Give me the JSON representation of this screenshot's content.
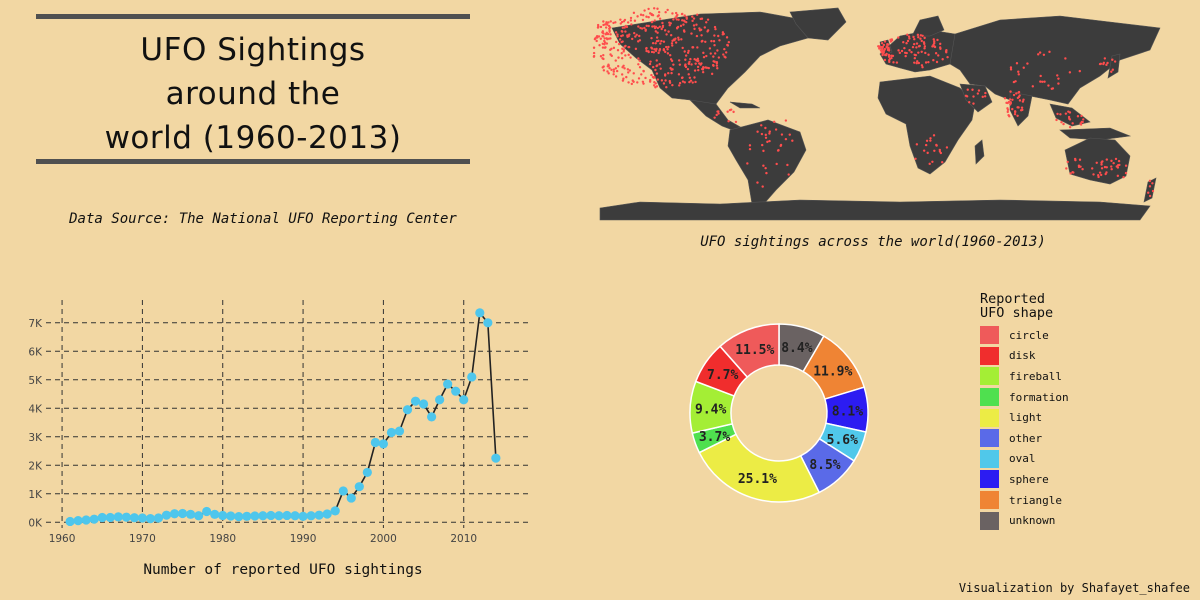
{
  "title": "UFO Sightings\naround the\nworld (1960-2013)",
  "data_source": "Data Source: The National UFO Reporting Center",
  "map_caption": "UFO sightings across the world(1960-2013)",
  "line_caption": "Number of reported UFO sightings",
  "credit": "Visualization by Shafayet_shafee",
  "colors": {
    "background": "#f2d7a3",
    "land": "#3c3c3c",
    "sighting": "#ff4d4d",
    "line_marker": "#4ec6ec"
  },
  "chart_data": [
    {
      "type": "line",
      "title": "Number of reported UFO sightings",
      "x": [
        1961,
        1962,
        1963,
        1964,
        1965,
        1966,
        1967,
        1968,
        1969,
        1970,
        1971,
        1972,
        1973,
        1974,
        1975,
        1976,
        1977,
        1978,
        1979,
        1980,
        1981,
        1982,
        1983,
        1984,
        1985,
        1986,
        1987,
        1988,
        1989,
        1990,
        1991,
        1992,
        1993,
        1994,
        1995,
        1996,
        1997,
        1998,
        1999,
        2000,
        2001,
        2002,
        2003,
        2004,
        2005,
        2006,
        2007,
        2008,
        2009,
        2010,
        2011,
        2012,
        2013,
        2014
      ],
      "y": [
        30,
        60,
        80,
        110,
        170,
        170,
        190,
        180,
        160,
        150,
        130,
        150,
        250,
        300,
        310,
        280,
        230,
        380,
        280,
        240,
        220,
        200,
        210,
        220,
        230,
        240,
        230,
        240,
        230,
        210,
        230,
        250,
        290,
        400,
        1100,
        850,
        1250,
        1750,
        2800,
        2750,
        3150,
        3200,
        3950,
        4250,
        4150,
        3700,
        4300,
        4850,
        4600,
        4300,
        5100,
        7350,
        7000,
        2250
      ],
      "xticks": [
        1960,
        1970,
        1980,
        1990,
        2000,
        2010
      ],
      "yticks": [
        0,
        1000,
        2000,
        3000,
        4000,
        5000,
        6000,
        7000
      ],
      "ytick_labels": [
        "0K",
        "1K",
        "2K",
        "3K",
        "4K",
        "5K",
        "6K",
        "7K"
      ],
      "xlim": [
        1958,
        2018
      ],
      "ylim": [
        -200,
        7800
      ],
      "grid": true
    },
    {
      "type": "pie",
      "hole": true,
      "legend_title": "Reported\nUFO shape",
      "legend_position": "right",
      "slices": [
        {
          "label": "circle",
          "percent": 11.5,
          "text": "11.5%",
          "color": "#ef5a5a"
        },
        {
          "label": "disk",
          "percent": 7.7,
          "text": "7.7%",
          "color": "#f02d2d"
        },
        {
          "label": "fireball",
          "percent": 9.4,
          "text": "9.4%",
          "color": "#a4ee35"
        },
        {
          "label": "formation",
          "percent": 3.7,
          "text": "3.7%",
          "color": "#4fe04f"
        },
        {
          "label": "light",
          "percent": 25.1,
          "text": "25.1%",
          "color": "#ecec45"
        },
        {
          "label": "other",
          "percent": 8.5,
          "text": "8.5%",
          "color": "#5a6ae8"
        },
        {
          "label": "oval",
          "percent": 5.6,
          "text": "5.6%",
          "color": "#50c8ea"
        },
        {
          "label": "sphere",
          "percent": 8.1,
          "text": "8.1%",
          "color": "#2c1cf2"
        },
        {
          "label": "triangle",
          "percent": 11.9,
          "text": "11.9%",
          "color": "#ef8434"
        },
        {
          "label": "unknown",
          "percent": 8.4,
          "text": "8.4%",
          "color": "#6a6262"
        }
      ]
    }
  ]
}
